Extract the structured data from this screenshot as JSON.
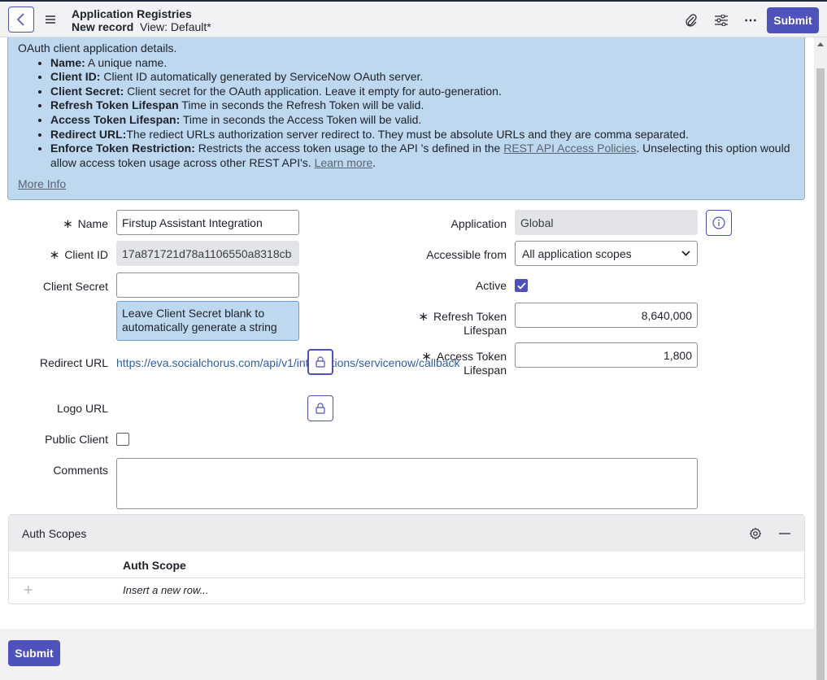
{
  "header": {
    "title": "Application Registries",
    "record": "New record",
    "view": "View: Default*",
    "submit_label": "Submit",
    "more_icon": "⋯"
  },
  "info": {
    "intro": "OAuth client application details.",
    "items": [
      {
        "term": "Name:",
        "text": " A unique name."
      },
      {
        "term": "Client ID:",
        "text": " Client ID automatically generated by ServiceNow OAuth server."
      },
      {
        "term": "Client Secret:",
        "text": " Client secret for the OAuth application. Leave it empty for auto-generation."
      },
      {
        "term": "Refresh Token Lifespan",
        "text": " Time in seconds the Refresh Token will be valid."
      },
      {
        "term": "Access Token Lifespan:",
        "text": " Time in seconds the Access Token will be valid."
      },
      {
        "term": "Redirect URL:",
        "text": "The rediect URLs authorization server redirect to. They must be absolute URLs and they are comma separated."
      },
      {
        "term": "Enforce Token Restriction:",
        "text_before": " Restricts the access token usage to the API 's defined in the ",
        "link1": "REST API Access Policies",
        "text_mid": ". Unselecting this option would allow access token usage across other REST API's. ",
        "link2": "Learn more",
        "text_after": "."
      }
    ],
    "more_info": "More Info"
  },
  "form": {
    "name_label": "Name",
    "name_value": "Firstup Assistant Integration",
    "client_id_label": "Client ID",
    "client_id_value": "17a871721d78a1106550a8318cb",
    "client_secret_label": "Client Secret",
    "client_secret_value": "",
    "client_secret_hint": "Leave Client Secret blank to automatically generate a string",
    "redirect_label": "Redirect URL",
    "redirect_value": "https://eva.socialchorus.com/api/v1/integrations/servicenow/callback",
    "logo_label": "Logo URL",
    "public_client_label": "Public Client",
    "comments_label": "Comments",
    "application_label": "Application",
    "application_value": "Global",
    "accessible_label": "Accessible from",
    "accessible_value": "All application scopes",
    "active_label": "Active",
    "refresh_label_1": "Refresh Token",
    "refresh_label_2": "Lifespan",
    "refresh_value": "8,640,000",
    "access_label_1": "Access Token",
    "access_label_2": "Lifespan",
    "access_value": "1,800",
    "required_mark": "∗"
  },
  "related": {
    "title": "Auth Scopes",
    "column": "Auth Scope",
    "insert_row": "Insert a new row...",
    "plus": "+"
  },
  "footer": {
    "submit_label": "Submit"
  }
}
